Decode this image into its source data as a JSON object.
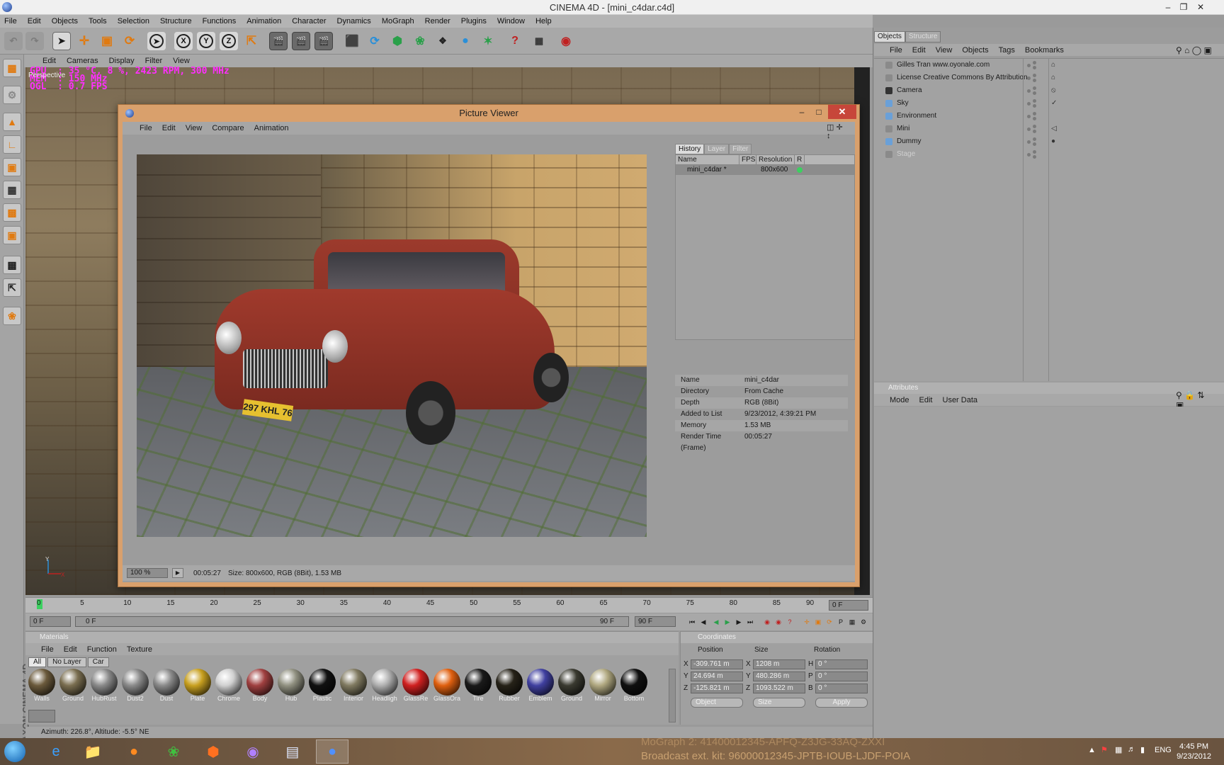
{
  "window": {
    "title": "CINEMA 4D - [mini_c4dar.c4d]"
  },
  "menubar": [
    "File",
    "Edit",
    "Objects",
    "Tools",
    "Selection",
    "Structure",
    "Functions",
    "Animation",
    "Character",
    "Dynamics",
    "MoGraph",
    "Render",
    "Plugins",
    "Window",
    "Help"
  ],
  "viewport": {
    "menu": [
      "Edit",
      "Cameras",
      "Display",
      "Filter",
      "View"
    ],
    "label": "Perspective",
    "hud": [
      "GPU  : 35 °C, 8 %, 2423 RPM, 300 MHz",
      "MEM  : 150 MHz",
      "OGL  : 0.7 FPS"
    ],
    "axis_y": "Y",
    "axis_x": "X"
  },
  "picture_viewer": {
    "title": "Picture Viewer",
    "menu": [
      "File",
      "Edit",
      "View",
      "Compare",
      "Animation"
    ],
    "tabs": [
      "History",
      "Layer",
      "Filter"
    ],
    "history_columns": [
      "Name",
      "FPS",
      "Resolution",
      "R"
    ],
    "history_rows": [
      {
        "name": "mini_c4dar *",
        "fps": "",
        "resolution": "800x600"
      }
    ],
    "plate_text": "297 KHL 76",
    "info": [
      {
        "k": "Name",
        "v": "mini_c4dar"
      },
      {
        "k": "Directory",
        "v": "From Cache"
      },
      {
        "k": "Depth",
        "v": "RGB (8Bit)"
      },
      {
        "k": "Added to List",
        "v": "9/23/2012, 4:39:21 PM"
      },
      {
        "k": "Memory",
        "v": "1.53 MB"
      },
      {
        "k": "Render Time (Frame)",
        "v": "00:05:27"
      }
    ],
    "status": {
      "zoom": "100 %",
      "time": "00:05:27",
      "size": "Size: 800x600, RGB (8Bit), 1.53 MB"
    }
  },
  "timeline": {
    "ticks": [
      "0",
      "5",
      "10",
      "15",
      "20",
      "25",
      "30",
      "35",
      "40",
      "45",
      "50",
      "55",
      "60",
      "65",
      "70",
      "75",
      "80",
      "85",
      "90"
    ],
    "current": "0 F",
    "start": "0 F",
    "range_start": "0 F",
    "range_end": "90 F",
    "end": "90 F"
  },
  "materials": {
    "title": "Materials",
    "menu": [
      "File",
      "Edit",
      "Function",
      "Texture"
    ],
    "filters": [
      "All",
      "No Layer",
      "Car"
    ],
    "items": [
      {
        "name": "Walls",
        "color": "#6b5a3c"
      },
      {
        "name": "Ground",
        "color": "#7a6e50"
      },
      {
        "name": "HubRust",
        "color": "#8a8a8a"
      },
      {
        "name": "Dust2",
        "color": "#8a8a8a"
      },
      {
        "name": "Dust",
        "color": "#8a8a8a"
      },
      {
        "name": "Plate",
        "color": "#c8a020"
      },
      {
        "name": "Chrome",
        "color": "#d0d0d0"
      },
      {
        "name": "Body",
        "color": "#a04040"
      },
      {
        "name": "Hub",
        "color": "#909080"
      },
      {
        "name": "Plastic",
        "color": "#111111"
      },
      {
        "name": "Interior",
        "color": "#807a60"
      },
      {
        "name": "Headligh",
        "color": "#b0b0b0"
      },
      {
        "name": "GlassRe",
        "color": "#d02020"
      },
      {
        "name": "GlassOra",
        "color": "#e06010"
      },
      {
        "name": "Tire",
        "color": "#1a1a1a"
      },
      {
        "name": "Rubber",
        "color": "#262218"
      },
      {
        "name": "Emblem",
        "color": "#4040a0"
      },
      {
        "name": "Ground",
        "color": "#3a3a30"
      },
      {
        "name": "Mirror",
        "color": "#b0a880"
      },
      {
        "name": "Bottom",
        "color": "#101010"
      }
    ]
  },
  "coordinates": {
    "title": "Coordinates",
    "headers": [
      "Position",
      "Size",
      "Rotation"
    ],
    "rows": [
      {
        "axis": "X",
        "pos": "-309.761 m",
        "size_axis": "X",
        "size": "1208 m",
        "rot_axis": "H",
        "rot": "0 °"
      },
      {
        "axis": "Y",
        "pos": "24.694 m",
        "size_axis": "Y",
        "size": "480.286 m",
        "rot_axis": "P",
        "rot": "0 °"
      },
      {
        "axis": "Z",
        "pos": "-125.821 m",
        "size_axis": "Z",
        "size": "1093.522 m",
        "rot_axis": "B",
        "rot": "0 °"
      }
    ],
    "mode": "Object",
    "size_mode": "Size",
    "apply": "Apply"
  },
  "status_bar": "Azimuth: 226.8°, Altitude: -5.5°  NE",
  "objects": {
    "tabs": [
      "Objects",
      "Structure"
    ],
    "menu": [
      "File",
      "Edit",
      "View",
      "Objects",
      "Tags",
      "Bookmarks"
    ],
    "items": [
      {
        "name": "Gilles Tran www.oyonale.com",
        "dim": false
      },
      {
        "name": "License Creative Commons By Attribution",
        "dim": false
      },
      {
        "name": "Camera",
        "dim": false
      },
      {
        "name": "Sky",
        "dim": false
      },
      {
        "name": "Environment",
        "dim": false
      },
      {
        "name": "Mini",
        "dim": false
      },
      {
        "name": "Dummy",
        "dim": false
      },
      {
        "name": "Stage",
        "dim": true
      }
    ]
  },
  "attributes": {
    "title": "Attributes",
    "menu": [
      "Mode",
      "Edit",
      "User Data"
    ]
  },
  "maxon_logo": "MAXON CINEMA 4D",
  "watermark": [
    "MoGraph 2: 41400012345-APFQ-Z3JG-33AQ-ZXXI",
    "Broadcast ext. kit: 96000012345-JPTB-IOUB-LJDF-POIA"
  ],
  "tray": {
    "lang": "ENG",
    "time": "4:45 PM",
    "date": "9/23/2012"
  }
}
